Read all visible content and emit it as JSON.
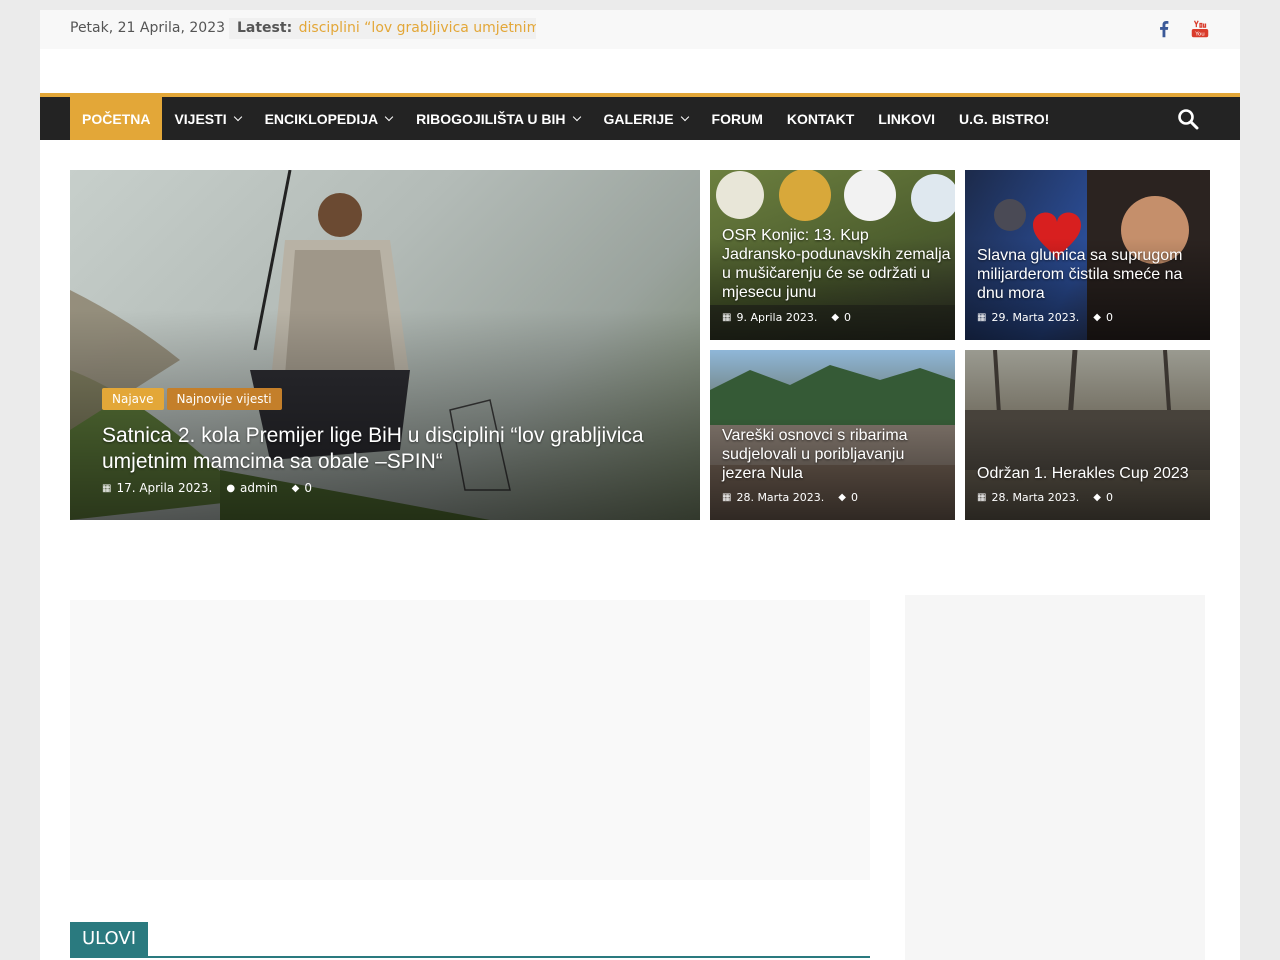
{
  "topbar": {
    "date": "Petak, 21 Aprila, 2023",
    "latest_label": "Latest:",
    "latest_text": "disciplini  “lov grabljivica umjetnim",
    "social": [
      "facebook-icon",
      "youtube-icon"
    ]
  },
  "nav": {
    "items": [
      {
        "label": "POČETNA",
        "active": true,
        "has_dropdown": false
      },
      {
        "label": "VIJESTI",
        "has_dropdown": true
      },
      {
        "label": "ENCIKLOPEDIJA",
        "has_dropdown": true
      },
      {
        "label": "RIBOGOJILIŠTA U BIH",
        "has_dropdown": true
      },
      {
        "label": "GALERIJE",
        "has_dropdown": true
      },
      {
        "label": "FORUM",
        "has_dropdown": false
      },
      {
        "label": "KONTAKT",
        "has_dropdown": false
      },
      {
        "label": "LINKOVI",
        "has_dropdown": false
      },
      {
        "label": "U.G. BISTRO!",
        "has_dropdown": false
      }
    ],
    "search_icon": "search-icon"
  },
  "featured": {
    "main": {
      "tags": [
        "Najave",
        "Najnovije vijesti"
      ],
      "title": "Satnica  2.  kola Premijer lige BiH u disciplini  “lov grabljivica umjetnim mamcima sa obale –SPIN“",
      "date": "17. Aprila 2023.",
      "author": "admin",
      "comments": "0"
    },
    "posts": [
      {
        "title": "OSR Konjic: 13. Kup Jadransko-podunavskih zemalja u mušičarenju će se održati u mjesecu junu",
        "date": "9. Aprila 2023.",
        "comments": "0"
      },
      {
        "title": "Slavna glumica sa suprugom milijarderom čistila smeće na dnu mora",
        "date": "29. Marta 2023.",
        "comments": "0"
      },
      {
        "title": "Vareški osnovci s ribarima sudjelovali u poribljavanju jezera Nula",
        "date": "28. Marta 2023.",
        "comments": "0"
      },
      {
        "title": "Održan 1. Herakles Cup 2023",
        "date": "28. Marta 2023.",
        "comments": "0"
      }
    ]
  },
  "section": {
    "label": "ULOVI"
  },
  "colors": {
    "accent": "#e3a738",
    "nav_bg": "#232323",
    "section": "#2a7a7f"
  }
}
